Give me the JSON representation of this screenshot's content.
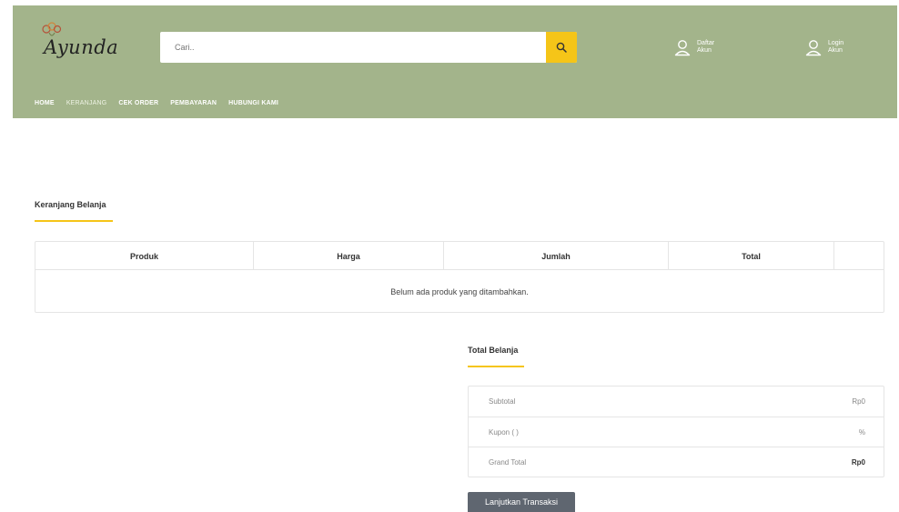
{
  "header": {
    "logo_text": "Ayunda",
    "search": {
      "placeholder": "Cari.."
    },
    "register": {
      "line1": "Daftar",
      "line2": "Akun"
    },
    "login": {
      "line1": "Login",
      "line2": "Akun"
    },
    "colors": {
      "bar": "#a3b48b",
      "accent": "#f5c518"
    }
  },
  "nav": {
    "items": [
      {
        "label": "HOME",
        "active": false
      },
      {
        "label": "KERANJANG",
        "active": true
      },
      {
        "label": "CEK ORDER",
        "active": false
      },
      {
        "label": "PEMBAYARAN",
        "active": false
      },
      {
        "label": "HUBUNGI KAMI",
        "active": false
      }
    ]
  },
  "cart": {
    "title": "Keranjang Belanja",
    "columns": [
      "Produk",
      "Harga",
      "Jumlah",
      "Total",
      ""
    ],
    "empty_message": "Belum ada produk yang ditambahkan."
  },
  "totals": {
    "title": "Total Belanja",
    "rows": [
      {
        "label": "Subtotal",
        "value": "Rp0"
      },
      {
        "label": "Kupon ( )",
        "value": "%"
      },
      {
        "label": "Grand Total",
        "value": "Rp0"
      }
    ],
    "button_label": "Lanjutkan Transaksi"
  }
}
